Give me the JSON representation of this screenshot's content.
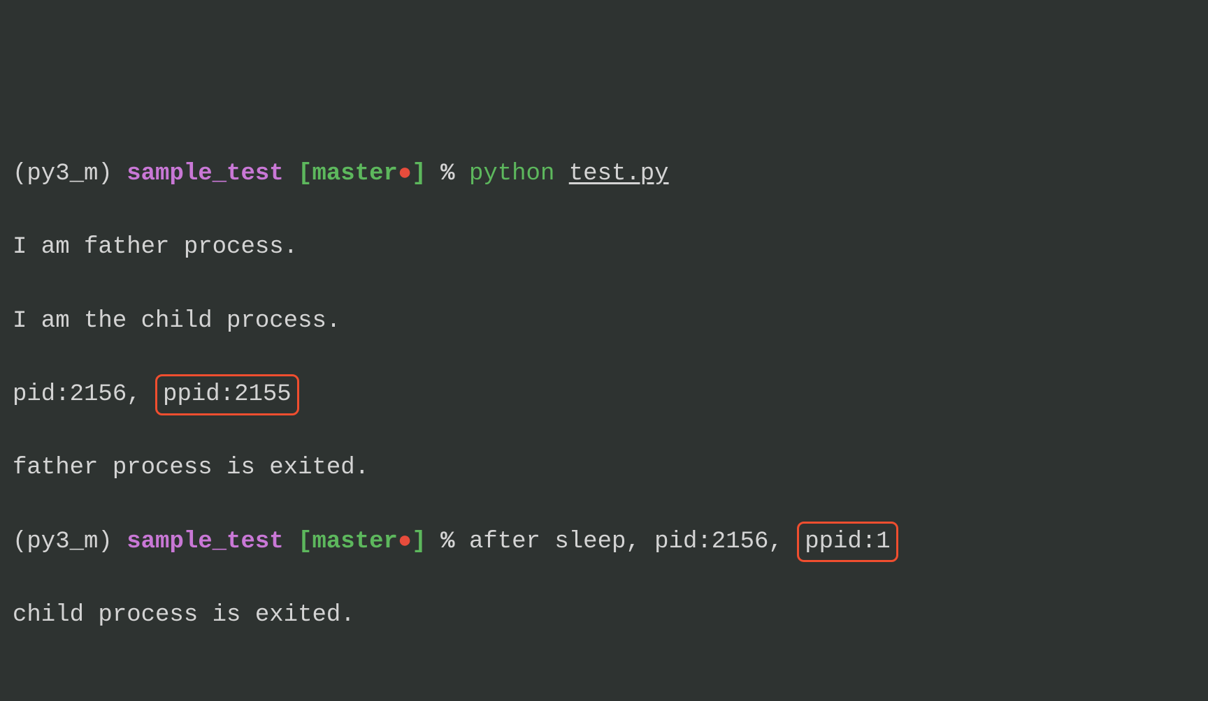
{
  "prompt1": {
    "env": "(py3_m)",
    "dir": "sample_test",
    "bracket_open": "[",
    "branch": "master",
    "bracket_close": "]",
    "symbol": "%",
    "command": "python",
    "arg": "test.py"
  },
  "output": {
    "line1": "I am father process.",
    "line2": "I am the child process.",
    "line3_prefix": "pid:2156, ",
    "line3_highlight": "ppid:2155",
    "line4": "father process is exited."
  },
  "prompt2": {
    "env": "(py3_m)",
    "dir": "sample_test",
    "bracket_open": "[",
    "branch": "master",
    "bracket_close": "]",
    "symbol": "%",
    "after_text": "after sleep, pid:2156, ",
    "highlight": "ppid:1"
  },
  "output2": {
    "line1": "child process is exited."
  }
}
